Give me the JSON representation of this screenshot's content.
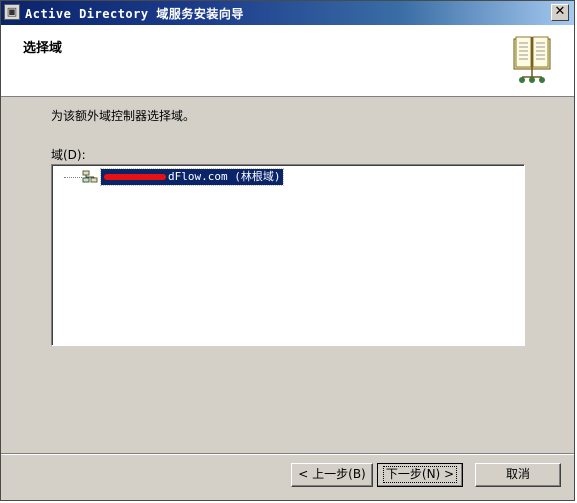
{
  "window": {
    "title": "Active Directory 域服务安装向导",
    "close_glyph": "✕"
  },
  "header": {
    "title": "选择域"
  },
  "main": {
    "instruction": "为该额外域控制器选择域。",
    "domain_label": "域(D):",
    "tree": {
      "selected_item_visible_text": "dFlow.com (林根域)"
    }
  },
  "footer": {
    "back_label": "< 上一步(B)",
    "next_label": "下一步(N) >",
    "cancel_label": "取消"
  },
  "colors": {
    "titlebar_start": "#0a246a",
    "titlebar_end": "#a6caf0",
    "selection": "#0a246a",
    "redaction": "#e81010"
  },
  "icons": {
    "app": "server-icon",
    "header": "book-icon",
    "domain": "domain-tree-icon"
  }
}
